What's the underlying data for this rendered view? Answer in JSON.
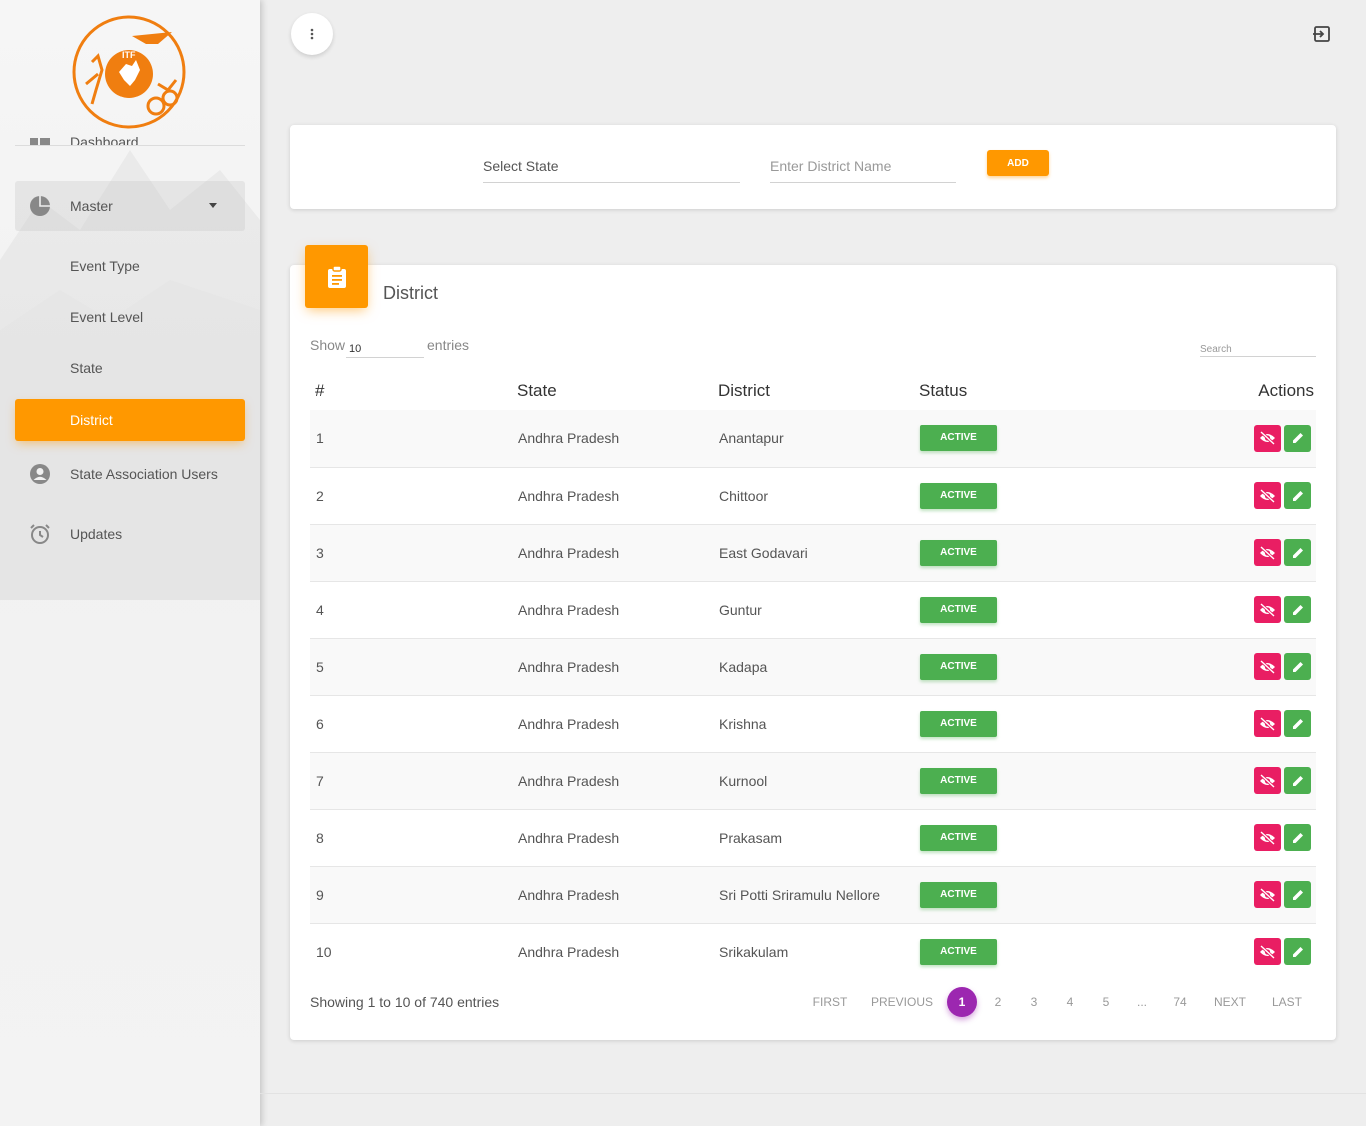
{
  "sidebar": {
    "logo_text": "ITF",
    "items": [
      {
        "label": "Dashboard"
      },
      {
        "label": "Master"
      },
      {
        "label": "Event Type"
      },
      {
        "label": "Event Level"
      },
      {
        "label": "State"
      },
      {
        "label": "District"
      },
      {
        "label": "State Association Users"
      },
      {
        "label": "Updates"
      }
    ]
  },
  "form": {
    "state_label": "Select State",
    "district_placeholder": "Enter District Name",
    "add_label": "ADD"
  },
  "card": {
    "title": "District",
    "show_label": "Show",
    "page_size": "10",
    "entries_label": "entries",
    "search_placeholder": "Search"
  },
  "table": {
    "headers": [
      "#",
      "State",
      "District",
      "Status",
      "Actions"
    ],
    "rows": [
      {
        "num": "1",
        "state": "Andhra Pradesh",
        "district": "Anantapur",
        "status": "ACTIVE"
      },
      {
        "num": "2",
        "state": "Andhra Pradesh",
        "district": "Chittoor",
        "status": "ACTIVE"
      },
      {
        "num": "3",
        "state": "Andhra Pradesh",
        "district": "East Godavari",
        "status": "ACTIVE"
      },
      {
        "num": "4",
        "state": "Andhra Pradesh",
        "district": "Guntur",
        "status": "ACTIVE"
      },
      {
        "num": "5",
        "state": "Andhra Pradesh",
        "district": "Kadapa",
        "status": "ACTIVE"
      },
      {
        "num": "6",
        "state": "Andhra Pradesh",
        "district": "Krishna",
        "status": "ACTIVE"
      },
      {
        "num": "7",
        "state": "Andhra Pradesh",
        "district": "Kurnool",
        "status": "ACTIVE"
      },
      {
        "num": "8",
        "state": "Andhra Pradesh",
        "district": "Prakasam",
        "status": "ACTIVE"
      },
      {
        "num": "9",
        "state": "Andhra Pradesh",
        "district": "Sri Potti Sriramulu Nellore",
        "status": "ACTIVE"
      },
      {
        "num": "10",
        "state": "Andhra Pradesh",
        "district": "Srikakulam",
        "status": "ACTIVE"
      }
    ]
  },
  "pagination": {
    "info": "Showing 1 to 10 of 740 entries",
    "first": "FIRST",
    "previous": "PREVIOUS",
    "pages": [
      "1",
      "2",
      "3",
      "4",
      "5",
      "...",
      "74"
    ],
    "current": "1",
    "next": "NEXT",
    "last": "LAST"
  },
  "colors": {
    "accent": "#ff9800",
    "status_active": "#4caf50",
    "hide_button": "#e91e63",
    "current_page": "#9c27b0"
  }
}
